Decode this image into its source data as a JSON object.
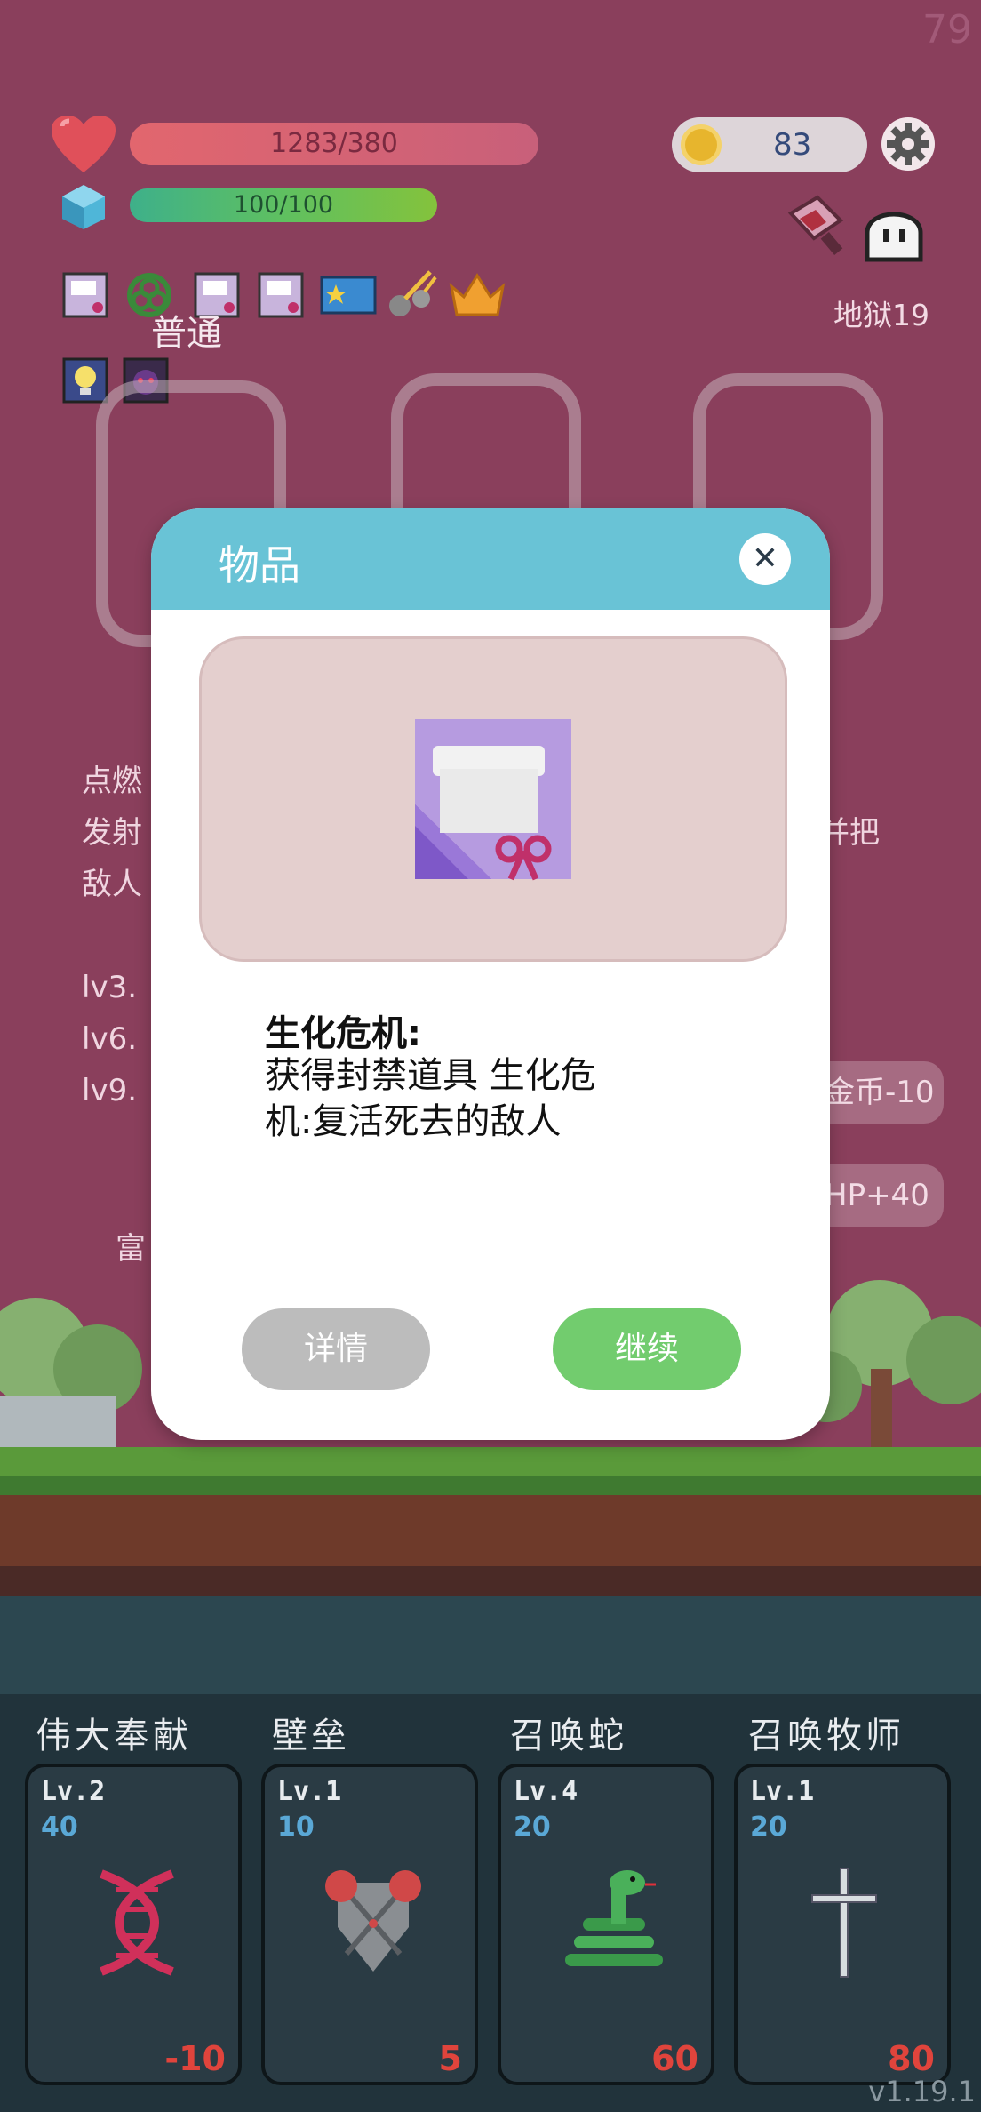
{
  "fps": "79",
  "hud": {
    "hp_text": "1283/380",
    "mp_text": "100/100",
    "coins": "83",
    "stage": "地狱19",
    "difficulty": "普通"
  },
  "background_text": {
    "line1": "点燃",
    "line2": "发射",
    "line2_right": "并把",
    "line3": "敌人",
    "lv3": "lv3.",
    "lv6": "lv6.",
    "lv9": "lv9.",
    "side_btn1": "金币-10",
    "side_btn2": "HP+40",
    "fragment": "富"
  },
  "modal": {
    "title": "物品",
    "close": "✕",
    "item_name": "生化危机:",
    "item_desc_line1": "获得封禁道具 生化危",
    "item_desc_line2": "机:复活死去的敌人",
    "detail_button": "详情",
    "continue_button": "继续"
  },
  "cards": [
    {
      "title": "伟大奉献",
      "level": "Lv.2",
      "cost": "40",
      "value": "-10",
      "icon": "dna-icon"
    },
    {
      "title": "壁垒",
      "level": "Lv.1",
      "cost": "10",
      "value": "5",
      "icon": "armor-icon"
    },
    {
      "title": "召唤蛇",
      "level": "Lv.4",
      "cost": "20",
      "value": "60",
      "icon": "snake-icon"
    },
    {
      "title": "召唤牧师",
      "level": "Lv.1",
      "cost": "20",
      "value": "80",
      "icon": "cross-icon"
    }
  ],
  "version": "v1.19.1",
  "colors": {
    "background": "#8a3f5c",
    "modal_header": "#69c3d6",
    "continue": "#72cc6e",
    "detail": "#bcbcbc",
    "card_value": "#e0443c",
    "card_cost": "#5aa8d6"
  }
}
